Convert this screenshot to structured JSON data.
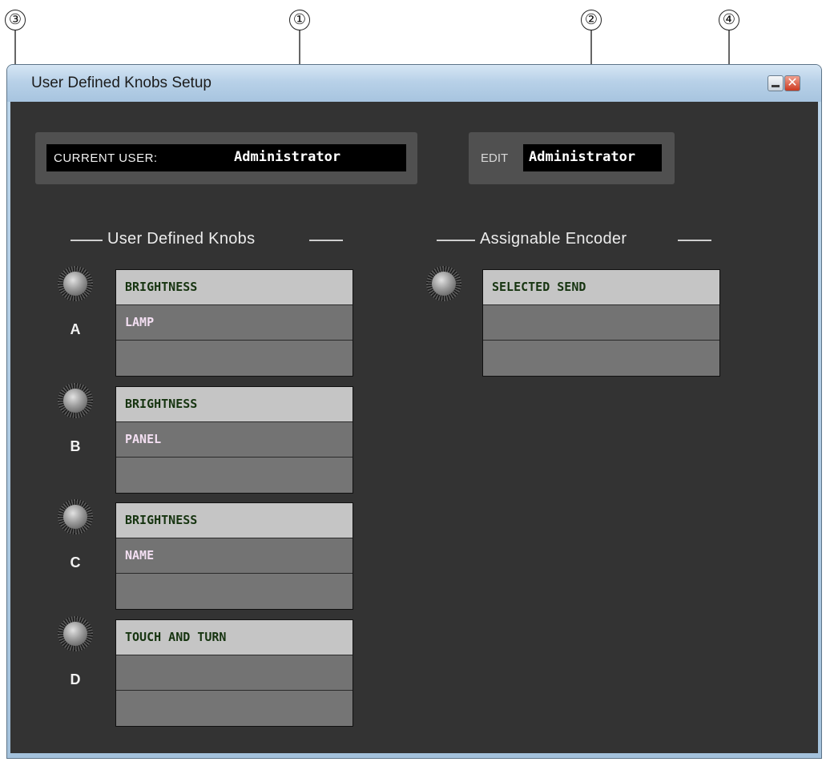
{
  "callouts": [
    "③",
    "①",
    "②",
    "④"
  ],
  "window": {
    "title": "User Defined Knobs Setup"
  },
  "current_user": {
    "label": "CURRENT USER:",
    "value": "Administrator"
  },
  "edit": {
    "label": "EDIT",
    "value": "Administrator"
  },
  "user_defined_knobs": {
    "heading": "User Defined Knobs",
    "knobs": [
      {
        "letter": "A",
        "slots": [
          "BRIGHTNESS",
          "LAMP",
          ""
        ]
      },
      {
        "letter": "B",
        "slots": [
          "BRIGHTNESS",
          "PANEL",
          ""
        ]
      },
      {
        "letter": "C",
        "slots": [
          "BRIGHTNESS",
          "NAME",
          ""
        ]
      },
      {
        "letter": "D",
        "slots": [
          "TOUCH AND TURN",
          "",
          ""
        ]
      }
    ]
  },
  "assignable_encoder": {
    "heading": "Assignable Encoder",
    "slots": [
      "SELECTED SEND",
      "",
      ""
    ]
  }
}
